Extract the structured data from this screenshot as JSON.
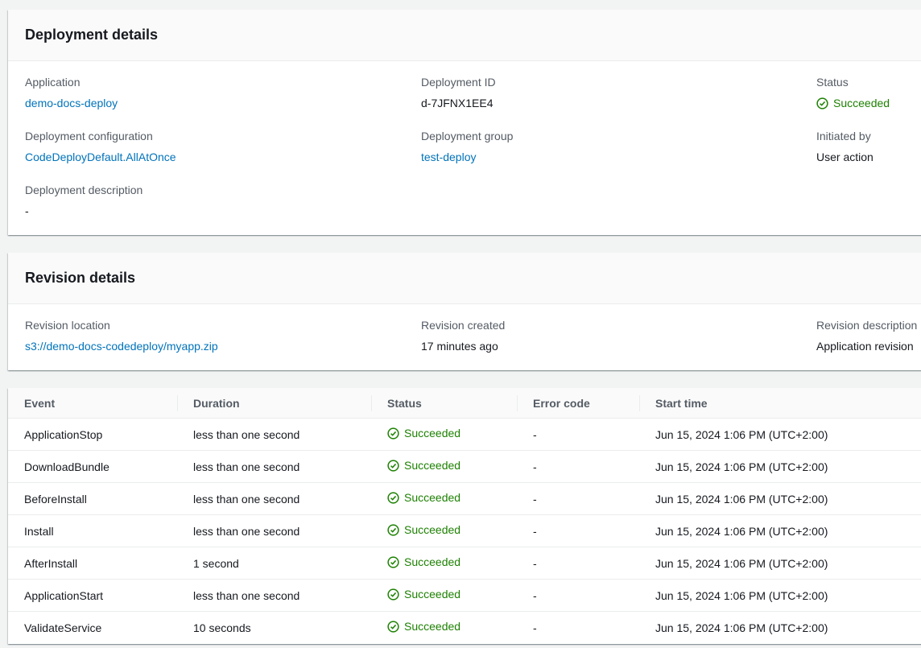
{
  "deployment": {
    "title": "Deployment details",
    "application_label": "Application",
    "application_value": "demo-docs-deploy",
    "deployment_id_label": "Deployment ID",
    "deployment_id_value": "d-7JFNX1EE4",
    "status_label": "Status",
    "status_value": "Succeeded",
    "config_label": "Deployment configuration",
    "config_value": "CodeDeployDefault.AllAtOnce",
    "group_label": "Deployment group",
    "group_value": "test-deploy",
    "initiated_label": "Initiated by",
    "initiated_value": "User action",
    "description_label": "Deployment description",
    "description_value": "-"
  },
  "revision": {
    "title": "Revision details",
    "location_label": "Revision location",
    "location_value": "s3://demo-docs-codedeploy/myapp.zip",
    "created_label": "Revision created",
    "created_value": "17 minutes ago",
    "description_label": "Revision description",
    "description_value": "Application revision"
  },
  "events": {
    "columns": [
      "Event",
      "Duration",
      "Status",
      "Error code",
      "Start time"
    ],
    "rows": [
      {
        "event": "ApplicationStop",
        "duration": "less than one second",
        "status": "Succeeded",
        "error": "-",
        "start": "Jun 15, 2024 1:06 PM (UTC+2:00)"
      },
      {
        "event": "DownloadBundle",
        "duration": "less than one second",
        "status": "Succeeded",
        "error": "-",
        "start": "Jun 15, 2024 1:06 PM (UTC+2:00)"
      },
      {
        "event": "BeforeInstall",
        "duration": "less than one second",
        "status": "Succeeded",
        "error": "-",
        "start": "Jun 15, 2024 1:06 PM (UTC+2:00)"
      },
      {
        "event": "Install",
        "duration": "less than one second",
        "status": "Succeeded",
        "error": "-",
        "start": "Jun 15, 2024 1:06 PM (UTC+2:00)"
      },
      {
        "event": "AfterInstall",
        "duration": "1 second",
        "status": "Succeeded",
        "error": "-",
        "start": "Jun 15, 2024 1:06 PM (UTC+2:00)"
      },
      {
        "event": "ApplicationStart",
        "duration": "less than one second",
        "status": "Succeeded",
        "error": "-",
        "start": "Jun 15, 2024 1:06 PM (UTC+2:00)"
      },
      {
        "event": "ValidateService",
        "duration": "10 seconds",
        "status": "Succeeded",
        "error": "-",
        "start": "Jun 15, 2024 1:06 PM (UTC+2:00)"
      }
    ]
  },
  "colors": {
    "link": "#0073bb",
    "success": "#1d8102"
  },
  "icons": {
    "status": "check-circle-icon"
  }
}
